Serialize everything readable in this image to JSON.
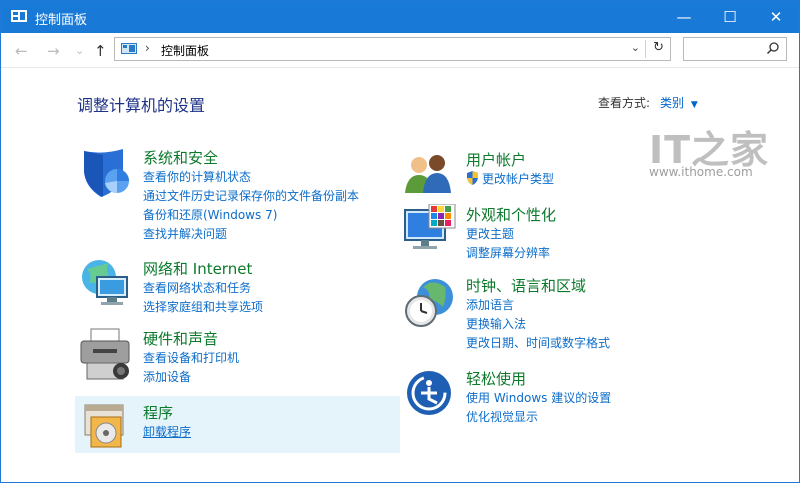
{
  "window": {
    "title": "控制面板",
    "controls": {
      "minimize": "—",
      "maximize": "☐",
      "close": "✕"
    }
  },
  "nav": {
    "back": "←",
    "forward": "→",
    "recent": "⌄",
    "up": "↑"
  },
  "address": {
    "separator": "›",
    "crumb": "控制面板",
    "dropdown": "⌄",
    "refresh": "↻"
  },
  "search": {
    "placeholder": ""
  },
  "heading": "调整计算机的设置",
  "viewby": {
    "label": "查看方式:",
    "value": "类别",
    "arrow": "▼"
  },
  "watermark": {
    "logo": "IT之家",
    "url": "www.ithome.com"
  },
  "colors": {
    "titlebar": "#1979d6",
    "category": "#0b7a2b",
    "link": "#0d6dc9",
    "heading": "#1e3287",
    "selection": "#e5f3fb"
  },
  "categories": [
    {
      "icon": "shield-icon",
      "title": "系统和安全",
      "links": [
        "查看你的计算机状态",
        "通过文件历史记录保存你的文件备份副本",
        "备份和还原(Windows 7)",
        "查找并解决问题"
      ]
    },
    {
      "icon": "network-icon",
      "title": "网络和 Internet",
      "links": [
        "查看网络状态和任务",
        "选择家庭组和共享选项"
      ]
    },
    {
      "icon": "printer-icon",
      "title": "硬件和声音",
      "links": [
        "查看设备和打印机",
        "添加设备"
      ]
    },
    {
      "icon": "programs-icon",
      "title": "程序",
      "links": [
        "卸载程序"
      ]
    },
    {
      "icon": "users-icon",
      "title": "用户帐户",
      "links": [
        "更改帐户类型"
      ]
    },
    {
      "icon": "appearance-icon",
      "title": "外观和个性化",
      "links": [
        "更改主题",
        "调整屏幕分辨率"
      ]
    },
    {
      "icon": "clock-globe-icon",
      "title": "时钟、语言和区域",
      "links": [
        "添加语言",
        "更换输入法",
        "更改日期、时间或数字格式"
      ]
    },
    {
      "icon": "ease-of-access-icon",
      "title": "轻松使用",
      "links": [
        "使用 Windows 建议的设置",
        "优化视觉显示"
      ]
    }
  ]
}
